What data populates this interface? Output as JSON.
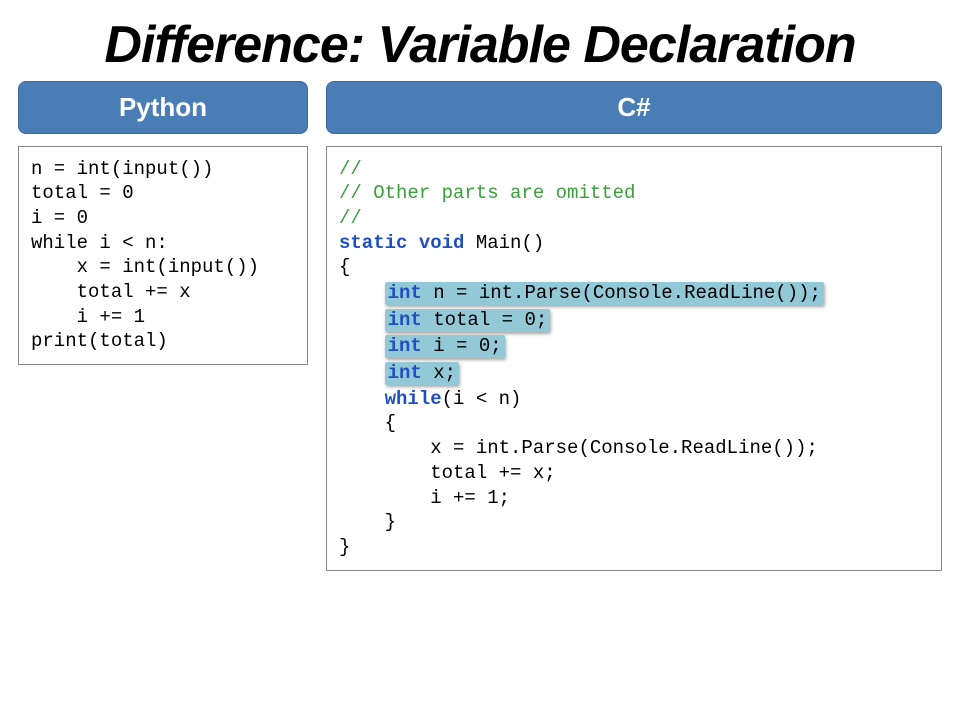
{
  "title": "Difference: Variable Declaration",
  "left": {
    "label": "Python",
    "code": "n = int(input())\ntotal = 0\ni = 0\nwhile i < n:\n    x = int(input())\n    total += x\n    i += 1\nprint(total)"
  },
  "right": {
    "label": "C#",
    "comment1": "//",
    "comment2": "// Other parts are omitted",
    "comment3": "//",
    "kw_staticvoid": "static void",
    "main_sig": " Main()",
    "open_brace": "{",
    "hl1_kw": "int",
    "hl1_rest": " n = int.Parse(Console.ReadLine());",
    "hl2_kw": "int",
    "hl2_rest": " total = 0;",
    "hl3_kw": "int",
    "hl3_rest": " i = 0;",
    "hl4_kw": "int",
    "hl4_rest": " x;",
    "kw_while": "while",
    "while_cond": "(i < n)",
    "inner_open": "    {",
    "line_x": "        x = int.Parse(Console.ReadLine());",
    "line_total": "        total += x;",
    "line_i": "        i += 1;",
    "inner_close": "    }",
    "close_brace": "}"
  }
}
